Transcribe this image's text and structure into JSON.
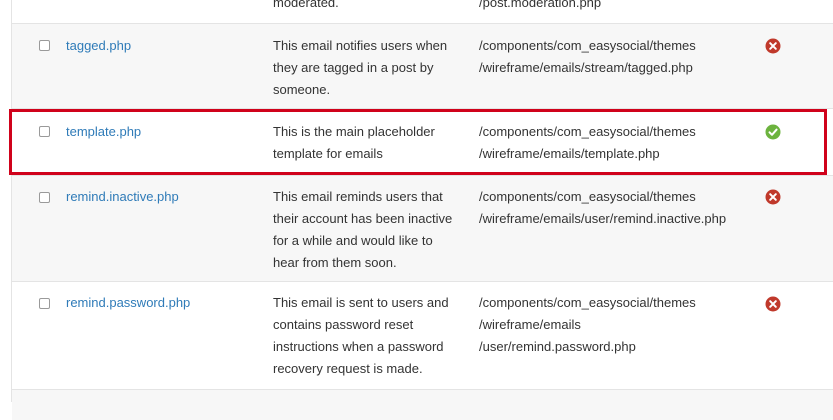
{
  "rows": [
    {
      "file": "",
      "desc": [
        "moderated."
      ],
      "path": [
        "/post.moderation.php"
      ],
      "status": "none"
    },
    {
      "file": "tagged.php",
      "desc": [
        "This email notifies users when",
        "they are tagged in a post by",
        "someone."
      ],
      "path": [
        "/components/com_easysocial/themes",
        "/wireframe/emails/stream/tagged.php"
      ],
      "status": "disabled"
    },
    {
      "file": "template.php",
      "desc": [
        "This is the main placeholder",
        "template for emails"
      ],
      "path": [
        "/components/com_easysocial/themes",
        "/wireframe/emails/template.php"
      ],
      "status": "enabled"
    },
    {
      "file": "remind.inactive.php",
      "desc": [
        "This email reminds users that",
        "their account has been inactive",
        "for a while and would like to",
        "hear from them soon."
      ],
      "path": [
        "/components/com_easysocial/themes",
        "/wireframe/emails/user/remind.inactive.php"
      ],
      "status": "disabled"
    },
    {
      "file": "remind.password.php",
      "desc": [
        "This email is sent to users and",
        "contains password reset",
        "instructions when a password",
        "recovery request is made."
      ],
      "path": [
        "/components/com_easysocial/themes",
        "/wireframe/emails",
        "/user/remind.password.php"
      ],
      "status": "disabled"
    }
  ],
  "colors": {
    "link": "#2f7bb8",
    "enabled": "#6cb33e",
    "disabled": "#c0392b",
    "highlight": "#d0021b"
  },
  "icons": {
    "enabled": "check-circle-icon",
    "disabled": "x-circle-icon"
  }
}
